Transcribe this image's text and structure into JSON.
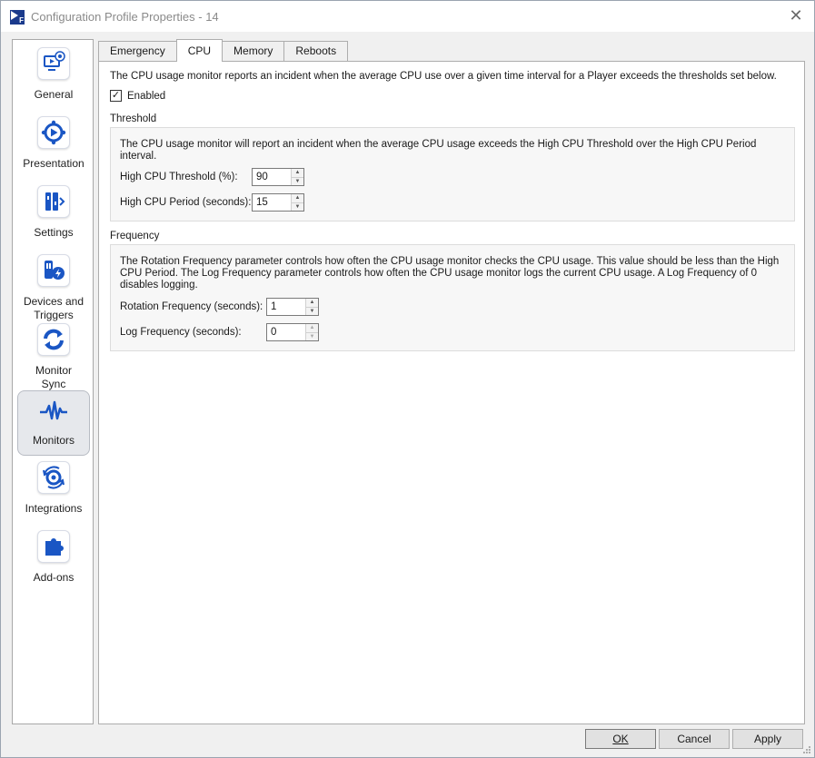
{
  "window": {
    "title": "Configuration Profile Properties - 14",
    "app_icon_letter": "F"
  },
  "sidebar": {
    "items": [
      {
        "label": "General",
        "icon": "monitor-gear-icon"
      },
      {
        "label": "Presentation",
        "icon": "presentation-play-icon"
      },
      {
        "label": "Settings",
        "icon": "settings-sliders-icon"
      },
      {
        "label": "Devices and Triggers",
        "icon": "device-lightning-icon"
      },
      {
        "label": "Monitor Sync",
        "icon": "sync-arrows-icon"
      },
      {
        "label": "Monitors",
        "icon": "pulse-wave-icon"
      },
      {
        "label": "Integrations",
        "icon": "integrations-gear-icon"
      },
      {
        "label": "Add-ons",
        "icon": "puzzle-piece-icon"
      }
    ],
    "active": "Monitors"
  },
  "tabs": [
    {
      "label": "Emergency"
    },
    {
      "label": "CPU"
    },
    {
      "label": "Memory"
    },
    {
      "label": "Reboots"
    }
  ],
  "cpu": {
    "intro": "The CPU usage monitor reports an incident when the average CPU use over a given time interval for a Player exceeds the thresholds set below.",
    "enabled_label": "Enabled",
    "enabled_check": "✓",
    "threshold": {
      "title": "Threshold",
      "description": "The CPU usage monitor will report an incident when the average CPU usage exceeds the High CPU Threshold over the High CPU Period interval.",
      "high_cpu_threshold_label": "High CPU Threshold (%):",
      "high_cpu_threshold_value": "90",
      "high_cpu_period_label": "High CPU Period (seconds):",
      "high_cpu_period_value": "15"
    },
    "frequency": {
      "title": "Frequency",
      "description": "The Rotation Frequency parameter controls how often the CPU usage monitor checks the CPU usage. This value should be less than the High CPU Period. The Log Frequency parameter controls how often the CPU usage monitor logs the current CPU usage. A Log Frequency of 0 disables logging.",
      "rotation_label": "Rotation Frequency (seconds):",
      "rotation_value": "1",
      "log_label": "Log Frequency (seconds):",
      "log_value": "0"
    }
  },
  "buttons": {
    "ok": "OK",
    "cancel": "Cancel",
    "apply": "Apply"
  },
  "glyphs": {
    "close": "✕",
    "spin_up": "▲",
    "spin_down": "▼"
  },
  "colors": {
    "accent_blue": "#1a56c4",
    "dark_blue": "#1a3a8c"
  }
}
